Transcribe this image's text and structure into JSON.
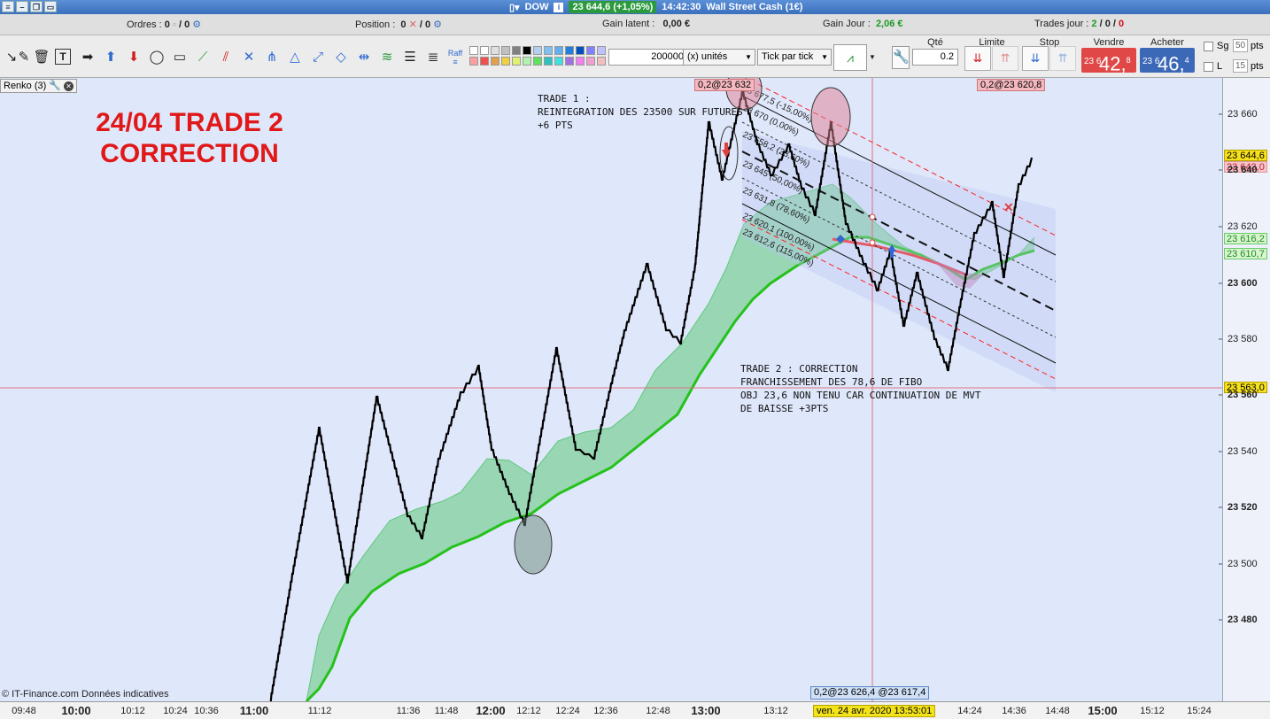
{
  "titlebar": {
    "instrument": "DOW",
    "ticker": "23 644,6 (+1,05%)",
    "time": "14:42:30",
    "market": "Wall Street Cash (1€)"
  },
  "orderbar": {
    "orders_label": "Ordres :",
    "orders_value": "0",
    "orders_sep": "/ 0",
    "position_label": "Position :",
    "position_value": "0",
    "position_sep": "/ 0",
    "latent_label": "Gain latent :",
    "latent_value": "0,00 €",
    "day_label": "Gain Jour :",
    "day_value": "2,06 €",
    "trades_label": "Trades jour :",
    "trades_a": "2",
    "trades_b": "/ 0 /",
    "trades_c": "0"
  },
  "toolbar": {
    "quantity_value": "200000",
    "unit_select": "(x) unités",
    "tick_select": "Tick par tick",
    "qte_label": "Qté",
    "qte_value": "0.2",
    "limit_label": "Limite",
    "stop_label": "Stop",
    "sell_label": "Vendre",
    "buy_label": "Acheter",
    "sell_small": "23 6",
    "sell_big": "42,",
    "sell_sup": "8",
    "buy_small": "23 6",
    "buy_big": "46,",
    "buy_sup": "4",
    "sg_label": "Sg",
    "sg_value": "50",
    "l_label": "L",
    "l_value": "15",
    "pts_label": "pts",
    "raff_label": "Raff"
  },
  "chart": {
    "indicator_tag": "Renko (3)",
    "banner_line1": "24/04 TRADE 2",
    "banner_line2": "CORRECTION",
    "note1": "TRADE 1 :\nREINTEGRATION DES 23500 SUR FUTURES\n+6 PTS",
    "note2": "TRADE 2 : CORRECTION\nFRANCHISSEMENT DES 78,6 DE FIBO\nOBJ 23,6 NON TENU CAR CONTINUATION DE MVT\nDE BAISSE +3PTS",
    "top_badge_left": "0,2@23 632",
    "top_badge_right": "0,2@23 620,8",
    "bottom_badge": "0,2@23 626,4 @23 617,4",
    "footer": "© IT-Finance.com  Données indicatives",
    "fib_labels": [
      "23 677,5 (-15,00%)",
      "23 670 (0,00%)",
      "23 658,2 (23,60%)",
      "23 645 (50,00%)",
      "23 631,8 (78,60%)",
      "23 620,1 (100,00%)",
      "23 612,6 (115,00%)"
    ],
    "price_ticks": [
      "23 660",
      "23 640",
      "23 620",
      "23 600",
      "23 580",
      "23 560",
      "23 540",
      "23 520",
      "23 500",
      "23 480"
    ],
    "price_badges": {
      "last": "23 644,6",
      "pink": "23 643,0",
      "green1": "23 616,2",
      "green2": "23 610,7",
      "cross": "23 563,0"
    },
    "colors": {
      "background": "#dfe7fb",
      "cloud": "#5ec97a",
      "upper_line": "#ff2020",
      "lower_line": "#25c21a",
      "fib_red": "#ff2020"
    }
  },
  "time_axis": {
    "labels": [
      "09:48",
      "10:00",
      "10:12",
      "10:24",
      "10:36",
      "11:00",
      "11:12",
      "11:36",
      "11:48",
      "12:00",
      "12:12",
      "12:24",
      "12:36",
      "12:48",
      "13:00",
      "13:12",
      "14:24",
      "14:36",
      "14:48",
      "15:00",
      "15:12",
      "15:24"
    ],
    "bold": [
      "10:00",
      "11:00",
      "12:00",
      "13:00",
      "15:00"
    ],
    "cursor_date": "ven. 24 avr. 2020 13:53:01"
  }
}
